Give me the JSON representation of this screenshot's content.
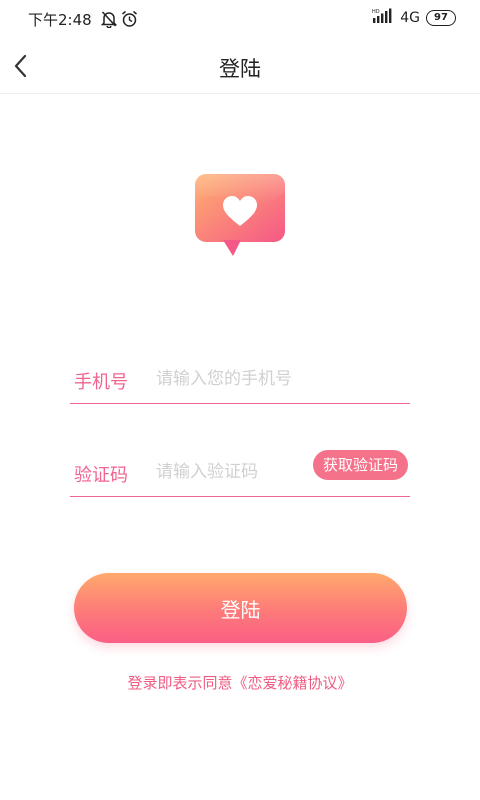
{
  "status_bar": {
    "time": "下午2:48",
    "network": "4G",
    "signal_label": "HD",
    "battery": "97",
    "icons": [
      "bell-off-icon",
      "alarm-icon",
      "signal-icon",
      "battery-icon"
    ]
  },
  "nav": {
    "title": "登陆",
    "back_icon": "chevron-left-icon"
  },
  "logo": {
    "icon": "heart-chat-bubble-icon",
    "colors": [
      "#ff9f6e",
      "#f75f86"
    ]
  },
  "form": {
    "phone": {
      "label": "手机号",
      "placeholder": "请输入您的手机号",
      "value": ""
    },
    "code": {
      "label": "验证码",
      "placeholder": "请输入验证码",
      "value": "",
      "button": "获取验证码"
    }
  },
  "login_button": {
    "label": "登陆"
  },
  "agreement": {
    "prefix": "登录即表示同意",
    "link": "《恋爱秘籍协议》"
  },
  "colors": {
    "accent": "#f06490",
    "button_gradient_top": "#ffa96c",
    "button_gradient_bottom": "#fb5f85",
    "placeholder": "#d0d0d0"
  }
}
